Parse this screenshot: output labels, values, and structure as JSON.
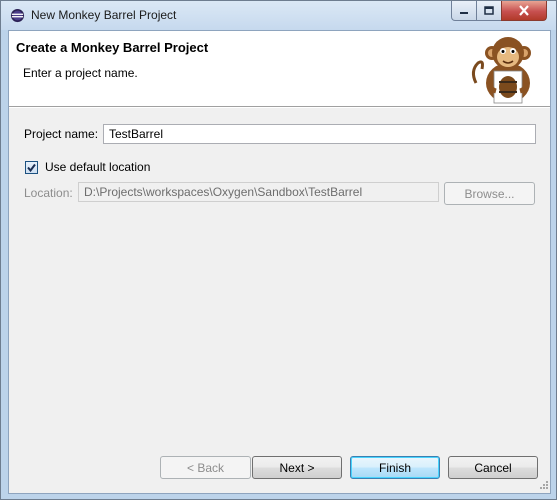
{
  "window": {
    "title": "New Monkey Barrel Project",
    "controls": {
      "minimize_icon": "minimize-icon",
      "maximize_icon": "maximize-icon",
      "close_icon": "close-icon"
    }
  },
  "banner": {
    "title": "Create a Monkey Barrel Project",
    "message": "Enter a project name.",
    "image_icon": "monkey-barrel-logo"
  },
  "form": {
    "project_name_label": "Project name:",
    "project_name_value": "TestBarrel",
    "use_default_label": "Use default location",
    "use_default_checked": true,
    "location_label": "Location:",
    "location_value": "D:\\Projects\\workspaces\\Oxygen\\Sandbox\\TestBarrel",
    "browse_label": "Browse..."
  },
  "buttons": {
    "back": "< Back",
    "next": "Next >",
    "finish": "Finish",
    "cancel": "Cancel"
  },
  "colors": {
    "frame": "#bcd3ea",
    "client": "#f0f0f0",
    "default_button_border": "#3c7fb1",
    "close_button": "#c75050"
  }
}
